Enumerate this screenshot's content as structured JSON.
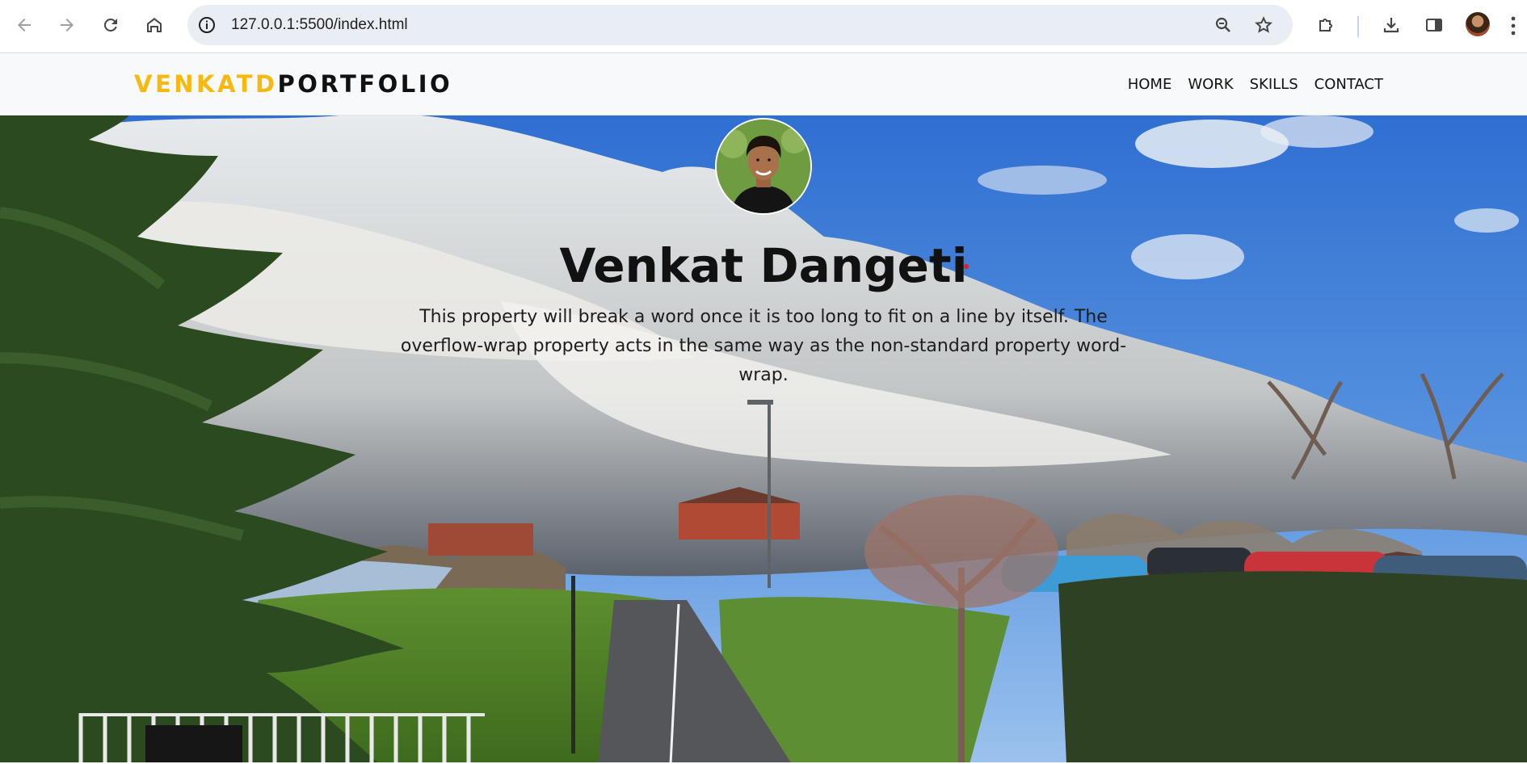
{
  "browser": {
    "url": "127.0.0.1:5500/index.html",
    "icons": {
      "back": "back-arrow-icon",
      "forward": "forward-arrow-icon",
      "reload": "reload-icon",
      "home": "home-icon",
      "site_info": "info-icon",
      "zoom": "zoom-icon",
      "bookmark": "star-icon",
      "extensions": "puzzle-icon",
      "downloads": "download-icon",
      "side_panel": "side-panel-icon",
      "profile": "profile-avatar",
      "menu": "kebab-menu-icon"
    }
  },
  "site": {
    "logo_primary": "VENKATD",
    "logo_secondary": "PORTFOLIO",
    "nav": [
      {
        "label": "HOME"
      },
      {
        "label": "WORK"
      },
      {
        "label": "SKILLS"
      },
      {
        "label": "CONTACT"
      }
    ],
    "hero": {
      "name": "Venkat Dangeti",
      "description": "This property will break a word once it is too long to fit on a line by itself. The overflow-wrap property acts in the same way as the non-standard property word-wrap."
    }
  },
  "colors": {
    "logo_accent": "#f7b90f",
    "logo_text": "#111111",
    "header_bg": "#f8f9fa",
    "omnibox_bg": "#e9edf4",
    "sky": "#3f7fd6"
  }
}
